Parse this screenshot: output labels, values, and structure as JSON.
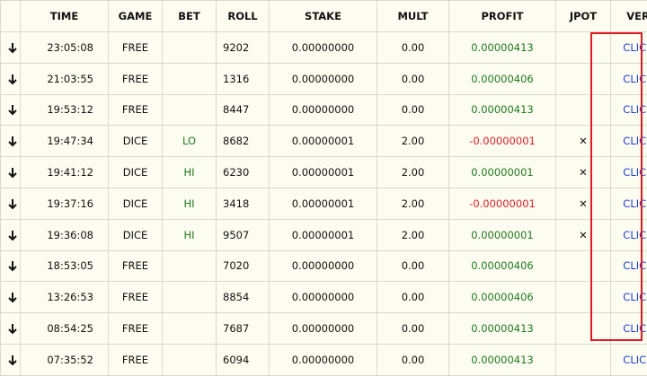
{
  "columns": [
    "TIME",
    "GAME",
    "BET",
    "ROLL",
    "STAKE",
    "MULT",
    "PROFIT",
    "JPOT",
    "VER"
  ],
  "colors": {
    "profit_positive": "#1f7a1f",
    "profit_negative": "#e0202a",
    "link": "#1f3fd0",
    "highlight": "#e21b23",
    "background": "#fdfcf0"
  },
  "row_icon": "arrow-down-icon",
  "rows": [
    {
      "time": "23:05:08",
      "game": "FREE",
      "bet": "",
      "roll": "9202",
      "stake": "0.00000000",
      "mult": "0.00",
      "profit": "0.00000413",
      "profit_sign": "pos",
      "jpot": "",
      "ver": "CLICK"
    },
    {
      "time": "21:03:55",
      "game": "FREE",
      "bet": "",
      "roll": "1316",
      "stake": "0.00000000",
      "mult": "0.00",
      "profit": "0.00000406",
      "profit_sign": "pos",
      "jpot": "",
      "ver": "CLICK"
    },
    {
      "time": "19:53:12",
      "game": "FREE",
      "bet": "",
      "roll": "8447",
      "stake": "0.00000000",
      "mult": "0.00",
      "profit": "0.00000413",
      "profit_sign": "pos",
      "jpot": "",
      "ver": "CLICK"
    },
    {
      "time": "19:47:34",
      "game": "DICE",
      "bet": "LO",
      "roll": "8682",
      "stake": "0.00000001",
      "mult": "2.00",
      "profit": "-0.00000001",
      "profit_sign": "neg",
      "jpot": "✕",
      "ver": "CLICK"
    },
    {
      "time": "19:41:12",
      "game": "DICE",
      "bet": "HI",
      "roll": "6230",
      "stake": "0.00000001",
      "mult": "2.00",
      "profit": "0.00000001",
      "profit_sign": "pos",
      "jpot": "✕",
      "ver": "CLICK"
    },
    {
      "time": "19:37:16",
      "game": "DICE",
      "bet": "HI",
      "roll": "3418",
      "stake": "0.00000001",
      "mult": "2.00",
      "profit": "-0.00000001",
      "profit_sign": "neg",
      "jpot": "✕",
      "ver": "CLICK"
    },
    {
      "time": "19:36:08",
      "game": "DICE",
      "bet": "HI",
      "roll": "9507",
      "stake": "0.00000001",
      "mult": "2.00",
      "profit": "0.00000001",
      "profit_sign": "pos",
      "jpot": "✕",
      "ver": "CLICK"
    },
    {
      "time": "18:53:05",
      "game": "FREE",
      "bet": "",
      "roll": "7020",
      "stake": "0.00000000",
      "mult": "0.00",
      "profit": "0.00000406",
      "profit_sign": "pos",
      "jpot": "",
      "ver": "CLICK"
    },
    {
      "time": "13:26:53",
      "game": "FREE",
      "bet": "",
      "roll": "8854",
      "stake": "0.00000000",
      "mult": "0.00",
      "profit": "0.00000406",
      "profit_sign": "pos",
      "jpot": "",
      "ver": "CLICK"
    },
    {
      "time": "08:54:25",
      "game": "FREE",
      "bet": "",
      "roll": "7687",
      "stake": "0.00000000",
      "mult": "0.00",
      "profit": "0.00000413",
      "profit_sign": "pos",
      "jpot": "",
      "ver": "CLICK"
    },
    {
      "time": "07:35:52",
      "game": "FREE",
      "bet": "",
      "roll": "6094",
      "stake": "0.00000000",
      "mult": "0.00",
      "profit": "0.00000413",
      "profit_sign": "pos",
      "jpot": "",
      "ver": "CLICK"
    }
  ]
}
